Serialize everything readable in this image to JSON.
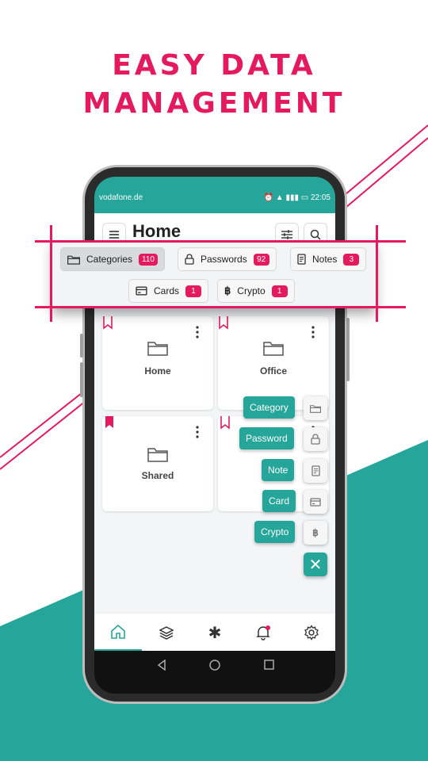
{
  "headline": {
    "line1": "EASY DATA",
    "line2": "MANAGEMENT"
  },
  "colors": {
    "accent": "#26a69a",
    "brand": "#e5195e",
    "background": "#ffffff"
  },
  "statusbar": {
    "carrier": "vodafone.de",
    "time": "22:05"
  },
  "appbar": {
    "title": "Home",
    "menu_icon": "menu-icon",
    "filter_icon": "sliders-icon",
    "search_icon": "search-icon"
  },
  "tabs": [
    {
      "label": "Categories",
      "count": "110",
      "icon": "folder-icon",
      "active": true
    },
    {
      "label": "Passwords",
      "count": "92",
      "icon": "lock-icon"
    },
    {
      "label": "Notes",
      "count": "3",
      "icon": "note-icon"
    },
    {
      "label": "Cards",
      "count": "1",
      "icon": "card-icon"
    },
    {
      "label": "Crypto",
      "count": "1",
      "icon": "bitcoin-icon"
    }
  ],
  "categories": [
    {
      "label": "Home"
    },
    {
      "label": "Office"
    },
    {
      "label": "Shared"
    },
    {
      "label": ""
    }
  ],
  "fab_menu": [
    {
      "label": "Category",
      "icon": "folder-icon"
    },
    {
      "label": "Password",
      "icon": "lock-icon"
    },
    {
      "label": "Note",
      "icon": "note-icon"
    },
    {
      "label": "Card",
      "icon": "card-icon"
    },
    {
      "label": "Crypto",
      "icon": "bitcoin-icon"
    }
  ],
  "bottom_nav": [
    "home-icon",
    "layers-icon",
    "asterisk-icon",
    "bell-icon",
    "gear-icon"
  ]
}
